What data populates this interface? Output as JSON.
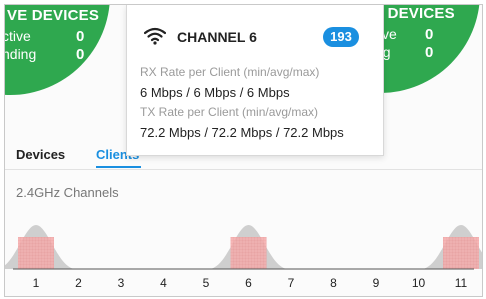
{
  "left_panel": {
    "title": "VE DEVICES",
    "rows": [
      {
        "label": "ctive",
        "value": "0"
      },
      {
        "label": "nding",
        "value": "0"
      }
    ]
  },
  "right_panel": {
    "title": "ACTIVE DEVICES",
    "rows": [
      {
        "label": "tive",
        "value": "0"
      },
      {
        "label": "ng",
        "value": "0"
      }
    ]
  },
  "popup": {
    "icon": "wifi-icon",
    "channel_title": "CHANNEL 6",
    "client_count": "193",
    "rx_label": "RX Rate per Client (min/avg/max)",
    "rx_value": "6 Mbps / 6 Mbps / 6 Mbps",
    "tx_label": "TX Rate per Client (min/avg/max)",
    "tx_value": "72.2 Mbps / 72.2 Mbps / 72.2 Mbps"
  },
  "tabs": [
    {
      "label": "Devices",
      "active": false
    },
    {
      "label": "Clients",
      "active": true
    }
  ],
  "section_label": "2.4GHz Channels",
  "colors": {
    "accent": "#1a8fe0",
    "green": "#2fa84f",
    "busy_fill": "#f3a3a3",
    "curve": "#cfcfcf"
  },
  "chart_data": {
    "type": "area",
    "categories": [
      "1",
      "2",
      "3",
      "4",
      "5",
      "6",
      "7",
      "8",
      "9",
      "10",
      "11"
    ],
    "active_channels": [
      "1",
      "6",
      "11"
    ]
  }
}
